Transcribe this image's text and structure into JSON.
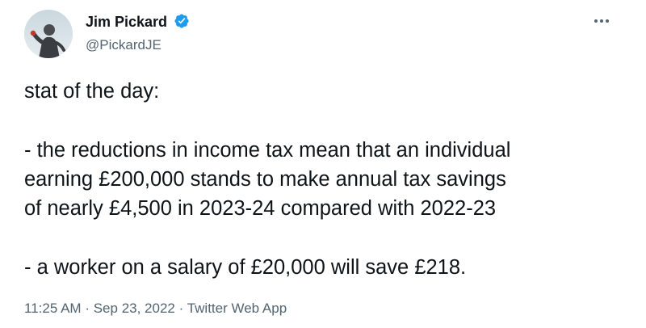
{
  "author": {
    "name": "Jim Pickard",
    "handle": "@PickardJE",
    "verified": true,
    "avatar_icon": "profile-avatar-icon",
    "verified_icon": "verified-badge-icon"
  },
  "more_icon": "more-options-icon",
  "tweet": {
    "lines": [
      "stat of the day:",
      "- the reductions in income tax mean that an individual",
      "earning £200,000 stands to make annual tax savings",
      "of nearly £4,500 in 2023-24 compared with 2022-23",
      "- a worker on a salary of £20,000 will save £218."
    ]
  },
  "meta": {
    "time": "11:25 AM",
    "separator": "·",
    "date": "Sep 23, 2022",
    "source": "Twitter Web App"
  },
  "colors": {
    "text": "#0f1419",
    "secondary": "#536471",
    "verified": "#1d9bf0"
  }
}
